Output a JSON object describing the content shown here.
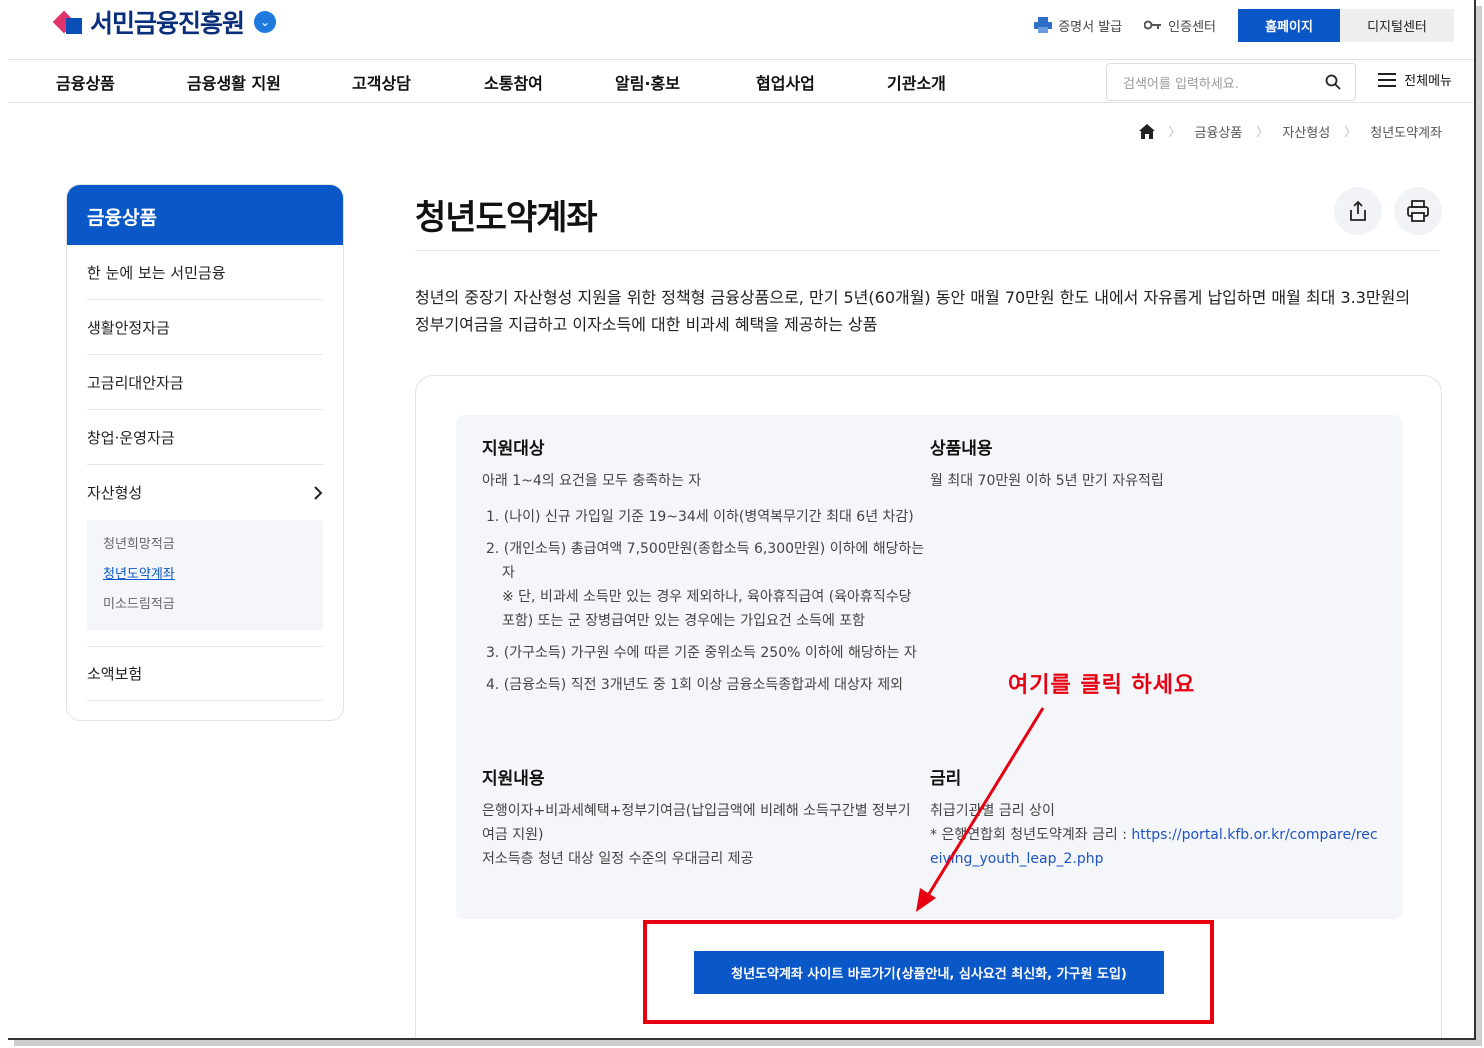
{
  "header": {
    "logo_text": "서민금융진흥원",
    "util": {
      "cert": "증명서 발급",
      "auth": "인증센터",
      "home": "홈페이지",
      "digital": "디지털센터"
    }
  },
  "gnb": {
    "items": [
      "금융상품",
      "금융생활 지원",
      "고객상담",
      "소통참여",
      "알림·홍보",
      "협업사업",
      "기관소개"
    ],
    "search_placeholder": "검색어를 입력하세요.",
    "all_menu": "전체메뉴"
  },
  "breadcrumb": [
    "금융상품",
    "자산형성",
    "청년도약계좌"
  ],
  "sidebar": {
    "title": "금융상품",
    "items": [
      "한 눈에 보는 서민금융",
      "생활안정자금",
      "고금리대안자금",
      "창업·운영자금",
      "자산형성",
      "소액보험"
    ],
    "sub_items": [
      "청년희망적금",
      "청년도약계좌",
      "미소드림적금"
    ]
  },
  "content": {
    "title": "청년도약계좌",
    "description": "청년의 중장기 자산형성 지원을 위한 정책형 금융상품으로, 만기 5년(60개월) 동안 매월 70만원 한도 내에서 자유롭게 납입하면 매월 최대 3.3만원의 정부기여금을 지급하고 이자소득에 대한 비과세 혜택을 제공하는 상품",
    "target": {
      "heading": "지원대상",
      "intro": "아래 1~4의 요건을 모두 충족하는 자",
      "reqs": [
        "1. (나이) 신규 가입일 기준 19~34세 이하(병역복무기간 최대 6년 차감)",
        "2. (개인소득) 총급여액 7,500만원(종합소득 6,300만원) 이하에 해당하는 자",
        "※ 단, 비과세 소득만 있는 경우 제외하나, 육아휴직급여 (육아휴직수당 포함) 또는 군 장병급여만 있는 경우에는 가입요건 소득에 포함",
        "3. (가구소득) 가구원 수에 따른 기준 중위소득 250% 이하에 해당하는 자",
        "4. (금융소득) 직전 3개년도 중 1회 이상 금융소득종합과세 대상자 제외"
      ]
    },
    "product": {
      "heading": "상품내용",
      "text": "월 최대 70만원 이하 5년 만기 자유적립"
    },
    "support": {
      "heading": "지원내용",
      "line1": "은행이자+비과세혜택+정부기여금(납입금액에 비례해 소득구간별 정부기여금 지원)",
      "line2": "저소득층 청년 대상 일정 수준의 우대금리 제공"
    },
    "rate": {
      "heading": "금리",
      "line1": "취급기관별 금리 상이",
      "line2_prefix": "* 은행연합회 청년도약계좌 금리 : ",
      "url": "https://portal.kfb.or.kr/compare/receiving_youth_leap_2.php"
    },
    "cta": "청년도약계좌 사이트 바로가기(상품안내, 심사요건 최신화, 가구원 도입)"
  },
  "annotation": {
    "text": "여기를 클릭 하세요",
    "color": "#e60012"
  },
  "colors": {
    "primary": "#0a57c8",
    "panel": "#f4f6f9"
  }
}
